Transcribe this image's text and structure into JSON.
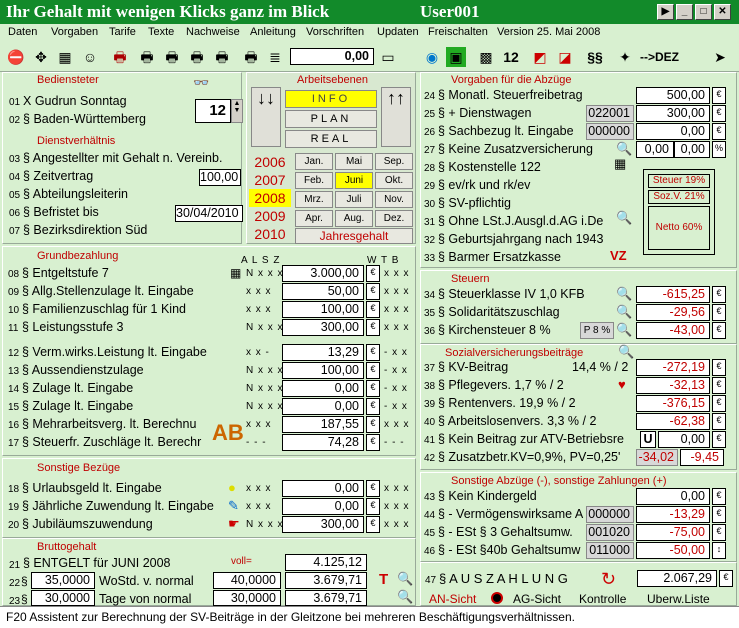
{
  "window": {
    "title": "Ihr Gehalt mit wenigen Klicks ganz im Blick",
    "user": "User001"
  },
  "menu": [
    "Daten",
    "Vorgaben",
    "Tarife",
    "Texte",
    "Nachweise",
    "Anleitung",
    "Vorschriften",
    "Updaten",
    "Freischalten",
    "Version 25. Mai 2008"
  ],
  "toolbar": {
    "value": "0,00",
    "dez": "-->DEZ"
  },
  "bediensteter": {
    "title": "Bediensteter",
    "name": "Gudrun Sonntag",
    "land": "Baden-Württemberg",
    "nr": "12"
  },
  "arbeitsebenen": {
    "title": "Arbeitsebenen",
    "info": "INFO",
    "plan": "PLAN",
    "real": "REAL"
  },
  "years": [
    "2006",
    "2007",
    "2008",
    "2009",
    "2010"
  ],
  "months": [
    "Jan.",
    "Mai",
    "Sep.",
    "Feb.",
    "Juni",
    "Okt.",
    "Mrz.",
    "Juli",
    "Nov.",
    "Apr.",
    "Aug.",
    "Dez."
  ],
  "jahresgehalt": "Jahresgehalt",
  "dienst": {
    "title": "Dienstverhältnis",
    "rows": [
      "§ Angestellter mit Gehalt n. Vereinb.",
      "§ Zeitvertrag",
      "§ Abteilungsleiterin",
      "§ Befristet bis",
      "§ Bezirksdirektion Süd"
    ],
    "nums": [
      "03",
      "04",
      "05",
      "06",
      "07"
    ],
    "zeit": "100,00",
    "bis": "30/04/2010"
  },
  "grund": {
    "title": "Grundbezahlung",
    "hdr": "A L S Z",
    "hdr2": "W T B",
    "rows": [
      {
        "n": "08",
        "l": "§ Entgeltstufe 7",
        "f": "N x x x",
        "v": "3.000,00"
      },
      {
        "n": "09",
        "l": "§ Allg.Stellenzulage lt. Eingabe",
        "f": "x x x",
        "v": "50,00"
      },
      {
        "n": "10",
        "l": "§ Familienzuschlag für 1 Kind",
        "f": "x x x",
        "v": "100,00"
      },
      {
        "n": "11",
        "l": "§ Leistungsstufe 3",
        "f": "N x x x",
        "v": "300,00"
      },
      {
        "n": "12",
        "l": "§ Verm.wirks.Leistung lt. Eingabe",
        "f": "x x -",
        "v": "13,29"
      },
      {
        "n": "13",
        "l": "§ Aussendienstzulage",
        "f": "N x x x",
        "v": "100,00"
      },
      {
        "n": "14",
        "l": "§ Zulage lt. Eingabe",
        "f": "N x x x",
        "v": "0,00"
      },
      {
        "n": "15",
        "l": "§ Zulage lt. Eingabe",
        "f": "N x x x",
        "v": "0,00"
      },
      {
        "n": "16",
        "l": "§ Mehrarbeitsverg. lt. Berechnu",
        "f": "x x x",
        "v": "187,55"
      },
      {
        "n": "17",
        "l": "§ Steuerfr. Zuschläge lt. Berechr",
        "f": "- - -",
        "v": "74,28"
      }
    ]
  },
  "sonstige": {
    "title": "Sonstige Bezüge",
    "rows": [
      {
        "n": "18",
        "l": "§ Urlaubsgeld lt. Eingabe",
        "f": "x x x",
        "v": "0,00"
      },
      {
        "n": "19",
        "l": "§ Jährliche Zuwendung lt. Eingabe",
        "f": "x x x",
        "v": "0,00"
      },
      {
        "n": "20",
        "l": "§ Jubiläumszuwendung",
        "f": "N x x x",
        "v": "300,00"
      }
    ]
  },
  "brutto": {
    "title": "Bruttogehalt",
    "r21": "§ ENTGELT für JUNI  2008",
    "voll": "voll=",
    "v21": "4.125,12",
    "a22": "35,0000",
    "l22": "WoStd. v. normal",
    "b22": "40,0000",
    "v22": "3.679,71",
    "a23": "30,0000",
    "l23": "Tage von normal",
    "b23": "30,0000",
    "v23": "3.679,71"
  },
  "abzuege": {
    "title": "Vorgaben für die Abzüge",
    "rows": [
      {
        "n": "24",
        "l": "§ Monatl. Steuerfreibetrag",
        "v": "500,00"
      },
      {
        "n": "25",
        "l": "§ + Dienstwagen",
        "c": "022001",
        "v": "300,00"
      },
      {
        "n": "26",
        "l": "§ Sachbezug lt. Eingabe",
        "c": "000000",
        "v": "0,00"
      },
      {
        "n": "27",
        "l": "§ Keine Zusatzversicherung",
        "v": "0,00",
        "v2": "0,00"
      },
      {
        "n": "28",
        "l": "§ Kostenstelle 122"
      },
      {
        "n": "29",
        "l": "§ ev/rk und rk/ev"
      },
      {
        "n": "30",
        "l": "§ SV-pflichtig"
      },
      {
        "n": "31",
        "l": "§ Ohne LSt.J.Ausgl.d.AG i.De"
      },
      {
        "n": "32",
        "l": "§ Geburtsjahrgang nach 1943"
      },
      {
        "n": "33",
        "l": "§ Barmer Ersatzkasse"
      }
    ],
    "steuer": "Steuer 19%",
    "sozv": "Soz.V. 21%",
    "netto": "Netto  60%"
  },
  "steuern": {
    "title": "Steuern",
    "rows": [
      {
        "n": "34",
        "l": "§ Steuerklasse IV   1,0 KFB",
        "v": "-615,25"
      },
      {
        "n": "35",
        "l": "§ Solidaritätszuschlag",
        "v": "-29,56"
      },
      {
        "n": "36",
        "l": "§ Kirchensteuer 8 %",
        "v": "-43,00"
      }
    ],
    "p8": "P 8 %"
  },
  "sv": {
    "title": "Sozialversicherungsbeiträge",
    "rows": [
      {
        "n": "37",
        "l": "§ KV-Beitrag",
        "m": "14,4 % / 2",
        "v": "-272,19"
      },
      {
        "n": "38",
        "l": "§ Pflegevers. 1,7 % / 2",
        "v": "-32,13"
      },
      {
        "n": "39",
        "l": "§ Rentenvers. 19,9 % / 2",
        "v": "-376,15"
      },
      {
        "n": "40",
        "l": "§ Arbeitslosenvers. 3,3 % / 2",
        "v": "-62,38"
      },
      {
        "n": "41",
        "l": "§ Kein Beitrag zur ATV-Betriebsre",
        "u": "U",
        "v": "0,00"
      },
      {
        "n": "42",
        "l": "§ Zusatzbetr.KV=0,9%, PV=0,25'",
        "v": "-34,02",
        "v2": "-9,45"
      }
    ]
  },
  "sonstab": {
    "title": "Sonstige Abzüge (-), sonstige Zahlungen (+)",
    "rows": [
      {
        "n": "43",
        "l": "§ Kein Kindergeld",
        "v": "0,00"
      },
      {
        "n": "44",
        "l": "§  - Vermögenswirksame A",
        "c": "000000",
        "v": "-13,29"
      },
      {
        "n": "45",
        "l": "§  - ESt § 3 Gehaltsumw.",
        "c": "001020",
        "v": "-75,00"
      },
      {
        "n": "46",
        "l": "§  - ESt §40b Gehaltsumw",
        "c": "011000",
        "v": "-50,00"
      }
    ]
  },
  "auszahlung": {
    "n": "47",
    "l": "§ A U S Z A H L U N G",
    "v": "2.067,29"
  },
  "bottom": {
    "an": "AN-Sicht",
    "ag": "AG-Sicht",
    "kontrolle": "Kontrolle",
    "uberw": "Uberw.Liste"
  },
  "status": "F20 Assistent zur Berechnung der SV-Beiträge in der Gleitzone bei mehreren Beschäftigungsverhältnissen."
}
